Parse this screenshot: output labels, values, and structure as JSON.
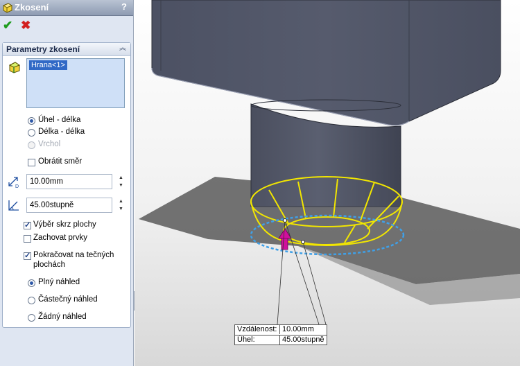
{
  "window": {
    "title": "Zkosení",
    "help": "?"
  },
  "actions": {
    "ok_icon": "check-icon",
    "cancel_icon": "close-icon"
  },
  "group": {
    "title": "Parametry zkosení",
    "selection_items": [
      "Hrana<1>"
    ],
    "modes": [
      {
        "label": "Úhel - délka",
        "selected": true,
        "enabled": true
      },
      {
        "label": "Délka - délka",
        "selected": false,
        "enabled": true
      },
      {
        "label": "Vrchol",
        "selected": false,
        "enabled": false
      }
    ],
    "flip_direction": {
      "label": "Obrátit směr",
      "checked": false
    },
    "distance": {
      "value": "10.00mm"
    },
    "angle": {
      "value": "45.00stupně"
    },
    "options": [
      {
        "label": "Výběr skrz plochy",
        "checked": true
      },
      {
        "label": "Zachovat prvky",
        "checked": false
      },
      {
        "label": "Pokračovat na tečných",
        "label2": "plochách",
        "checked": true
      }
    ],
    "preview": [
      {
        "label": "Plný náhled",
        "selected": true
      },
      {
        "label": "Částečný náhled",
        "selected": false
      },
      {
        "label": "Žádný náhled",
        "selected": false
      }
    ]
  },
  "callout": {
    "distance_label": "Vzdálenost:",
    "distance_value": "10.00mm",
    "angle_label": "Úhel:",
    "angle_value": "45.00stupně"
  },
  "colors": {
    "preview": "#f2e600",
    "edge": "#3fa0e8",
    "arrow": "#d0109c",
    "body": "#4e5364"
  }
}
